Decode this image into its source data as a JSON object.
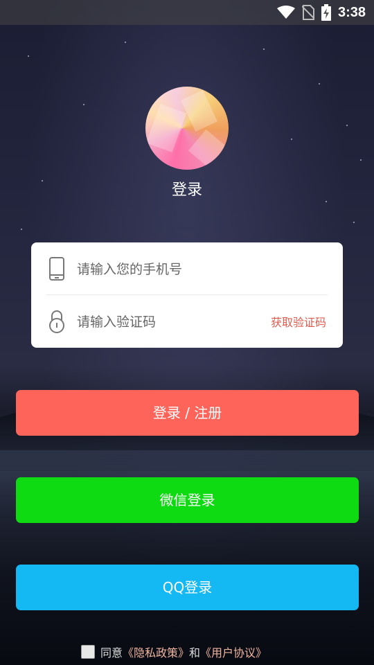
{
  "status_bar": {
    "time": "3:38",
    "icons": [
      "wifi-icon",
      "no-sim-icon",
      "battery-charging-icon"
    ]
  },
  "header": {
    "title": "登录"
  },
  "form": {
    "phone_placeholder": "请输入您的手机号",
    "code_placeholder": "请输入验证码",
    "get_code_label": "获取验证码",
    "phone_icon": "phone-icon",
    "lock_icon": "lock-icon"
  },
  "buttons": {
    "login_register": "登录 / 注册",
    "wechat_login": "微信登录",
    "qq_login": "QQ登录"
  },
  "agreement": {
    "prefix": "同意",
    "privacy_policy": "《隐私政策》",
    "and": "和",
    "user_agreement": "《用户协议》",
    "checked": false
  },
  "colors": {
    "login_button": "#ff645a",
    "wechat_button": "#0edb11",
    "qq_button": "#14b8f3",
    "get_code_link": "#e25a4d"
  }
}
